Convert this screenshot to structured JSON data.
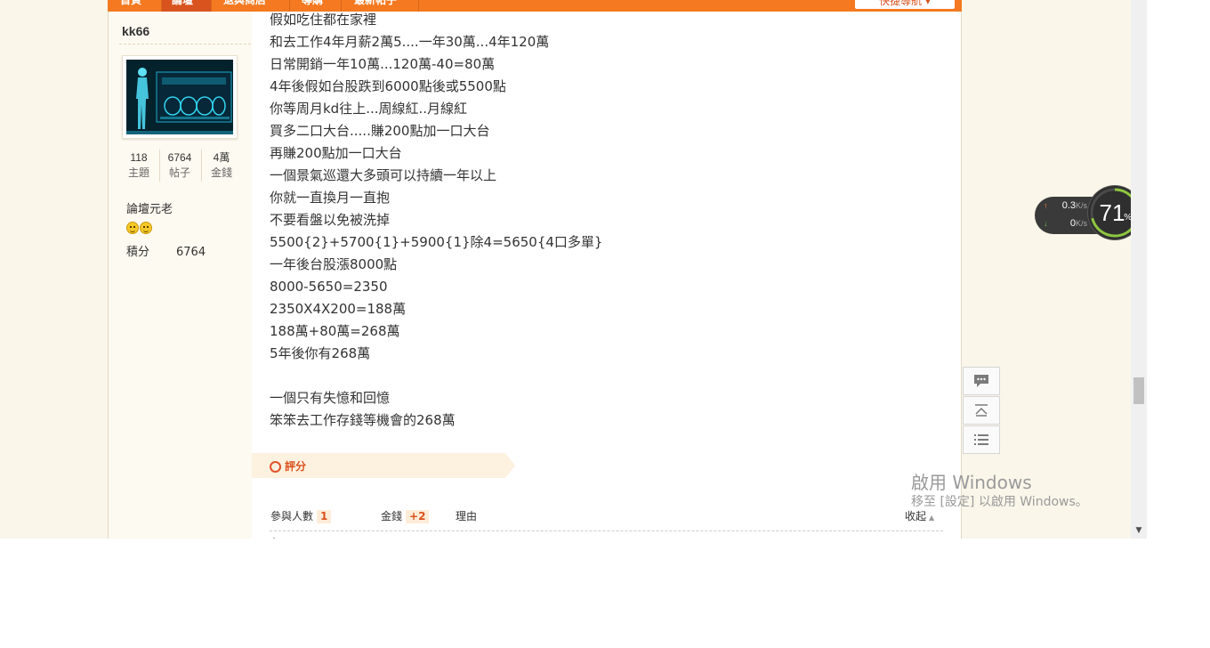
{
  "nav": {
    "items": [
      "首頁",
      "論壇",
      "退與商店",
      "導購",
      "最新帖子"
    ],
    "quick_nav": "快捷導航 ▾"
  },
  "user": {
    "name": "kk66",
    "stats": [
      {
        "value": "118",
        "label": "主題"
      },
      {
        "value": "6764",
        "label": "帖子"
      },
      {
        "value": "4萬",
        "label": "金錢"
      }
    ],
    "rank": "論壇元老",
    "points_label": "積分",
    "points_value": "6764"
  },
  "post": {
    "lines": [
      "假如吃住都在家裡",
      "和去工作4年月薪2萬5....一年30萬...4年120萬",
      "日常開銷一年10萬...120萬-40=80萬",
      "4年後假如台股跌到6000點後或5500點",
      "你等周月kd往上...周線紅..月線紅",
      "買多二口大台.....賺200點加一口大台",
      "再賺200點加一口大台",
      "一個景氣巡還大多頭可以持續一年以上",
      "你就一直換月一直抱",
      "不要看盤以免被洗掉",
      "5500{2}+5700{1}+5900{1}除4=5650{4口多單}",
      "一年後台股漲8000點",
      "8000-5650=2350",
      "2350X4X200=188萬",
      "188萬+80萬=268萬",
      "5年後你有268萬",
      "",
      "一個只有失憶和回憶",
      "笨笨去工作存錢等機會的268萬"
    ]
  },
  "rating": {
    "tab_label": "評分",
    "participants_label": "參與人數",
    "participants_count": "1",
    "money_label": "金錢",
    "money_value": "+2",
    "reason_label": "理由",
    "collapse_label": "收起",
    "partial_row": "+"
  },
  "net_widget": {
    "upload": "0.3",
    "download": "0",
    "unit": "K/s",
    "percent": "71",
    "percent_unit": "%",
    "percent_fraction": 0.71
  },
  "watermark": {
    "title": "啟用 Windows",
    "subtitle": "移至 [設定] 以啟用 Windows。"
  },
  "colors": {
    "nav_orange": "#f47920",
    "accent_red": "#d9531e",
    "page_bg": "#faf6ea",
    "meter_green": "#8dc63f",
    "meter_yellow": "#e8c22a"
  }
}
